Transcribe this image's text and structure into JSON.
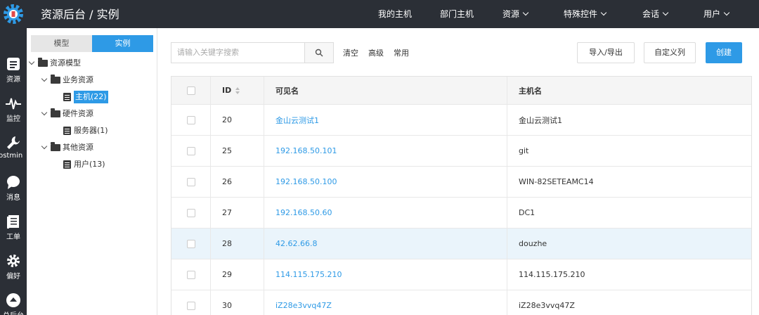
{
  "header": {
    "title": "资源后台 / 实例",
    "nav": [
      "我的主机",
      "部门主机",
      "资源",
      "特殊控件",
      "会话",
      "用户"
    ]
  },
  "rail": {
    "items": [
      {
        "label": "资源",
        "icon": "list-icon"
      },
      {
        "label": "监控",
        "icon": "pulse-icon"
      },
      {
        "label": "hostmin",
        "icon": "wrench-icon"
      },
      {
        "label": "消息",
        "icon": "chat-icon"
      },
      {
        "label": "工单",
        "icon": "ticket-icon"
      },
      {
        "label": "偏好",
        "icon": "gear-icon"
      },
      {
        "label": "总后台",
        "icon": "upload-icon"
      }
    ]
  },
  "tree": {
    "tab_model": "模型",
    "tab_instance": "实例",
    "root": "资源模型",
    "group_business": "业务资源",
    "item_host": "主机(22)",
    "group_hardware": "硬件资源",
    "item_server": "服务器(1)",
    "group_other": "其他资源",
    "item_user": "用户(13)"
  },
  "toolbar": {
    "search_placeholder": "请输入关键字搜索",
    "clear": "清空",
    "advanced": "高级",
    "common": "常用",
    "import_export": "导入/导出",
    "custom_columns": "自定义列",
    "create": "创建"
  },
  "table": {
    "columns": [
      "ID",
      "可见名",
      "主机名"
    ],
    "rows": [
      {
        "id": "20",
        "name": "金山云测试1",
        "host": "金山云测试1"
      },
      {
        "id": "25",
        "name": "192.168.50.101",
        "host": "git"
      },
      {
        "id": "26",
        "name": "192.168.50.100",
        "host": "WIN-82SETEAMC14"
      },
      {
        "id": "27",
        "name": "192.168.50.60",
        "host": "DC1"
      },
      {
        "id": "28",
        "name": "42.62.66.8",
        "host": "douzhe"
      },
      {
        "id": "29",
        "name": "114.115.175.210",
        "host": "114.115.175.210"
      },
      {
        "id": "30",
        "name": "iZ28e3vvq47Z",
        "host": "iZ28e3vvq47Z"
      }
    ],
    "highlighted_row": 4
  },
  "colors": {
    "accent": "#2e9ae6",
    "topbar": "#2b2f36",
    "highlight": "#eaf4fb"
  }
}
